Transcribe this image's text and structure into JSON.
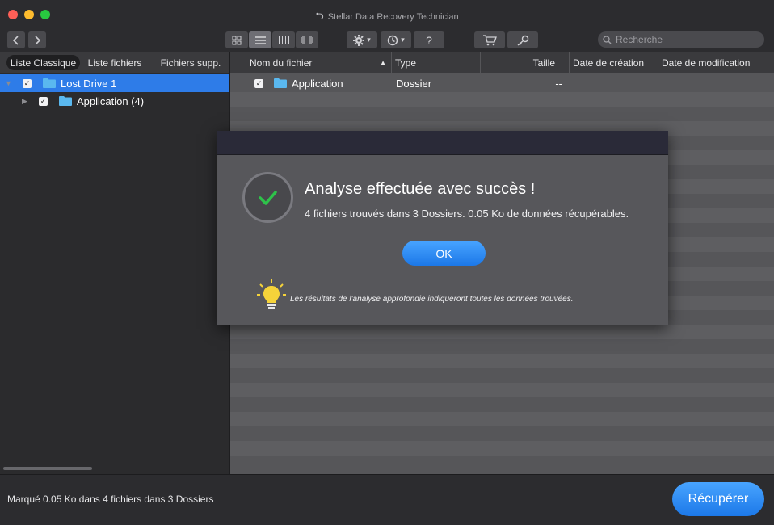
{
  "window": {
    "title": "Stellar Data Recovery Technician"
  },
  "toolbar": {
    "search_placeholder": "Recherche",
    "help_label": "?",
    "dropdown_arrow": "▾"
  },
  "sidebar": {
    "tabs": [
      {
        "label": "Liste Classique",
        "active": true
      },
      {
        "label": "Liste fichiers",
        "active": false
      },
      {
        "label": "Fichiers supp.",
        "active": false
      }
    ],
    "tree": [
      {
        "label": "Lost Drive 1",
        "selected": true,
        "checked": true
      },
      {
        "label": "Application (4)",
        "selected": false,
        "checked": true
      }
    ],
    "check_mark": "✓"
  },
  "table": {
    "columns": [
      "Nom du fichier",
      "Type",
      "Taille",
      "Date de création",
      "Date de modification"
    ],
    "sort_indicator": "▲",
    "rows": [
      {
        "name": "Application",
        "type": "Dossier",
        "size": "--",
        "created": "",
        "modified": ""
      }
    ]
  },
  "dialog": {
    "title": "Analyse effectuée avec succès !",
    "message": "4 fichiers trouvés dans 3 Dossiers. 0.05 Ko de données récupérables.",
    "ok_label": "OK",
    "hint": "Les résultats de l'analyse approfondie indiqueront toutes les données trouvées."
  },
  "status": {
    "text": "Marqué 0.05 Ko dans 4 fichiers dans 3 Dossiers",
    "recover_label": "Récupérer"
  },
  "colors": {
    "accent_blue": "#2e7ce8",
    "success_green": "#2ec24a",
    "bulb_yellow": "#f5d33a"
  }
}
